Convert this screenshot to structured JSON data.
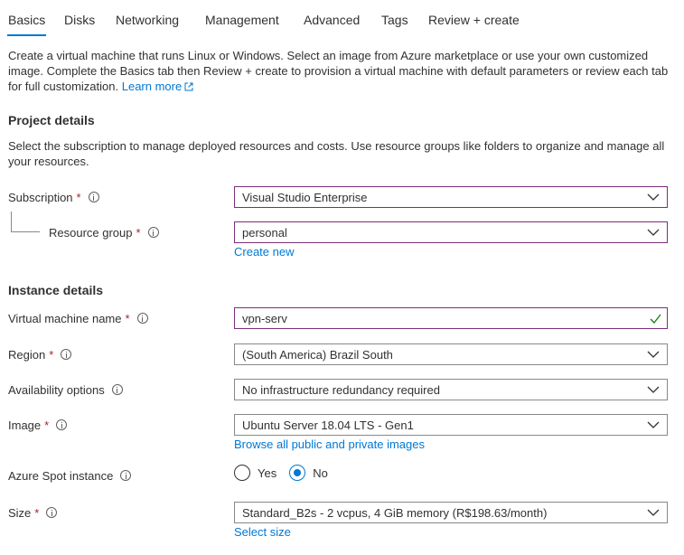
{
  "tabs": [
    {
      "label": "Basics",
      "active": true
    },
    {
      "label": "Disks"
    },
    {
      "label": "Networking"
    },
    {
      "label": "Management"
    },
    {
      "label": "Advanced"
    },
    {
      "label": "Tags"
    },
    {
      "label": "Review + create"
    }
  ],
  "intro": {
    "text": "Create a virtual machine that runs Linux or Windows. Select an image from Azure marketplace or use your own customized image. Complete the Basics tab then Review + create to provision a virtual machine with default parameters or review each tab for full customization.",
    "learn_more": "Learn more"
  },
  "project": {
    "heading": "Project details",
    "description": "Select the subscription to manage deployed resources and costs. Use resource groups like folders to organize and manage all your resources.",
    "subscription_label": "Subscription",
    "subscription_value": "Visual Studio Enterprise",
    "resource_group_label": "Resource group",
    "resource_group_value": "personal",
    "create_new": "Create new"
  },
  "instance": {
    "heading": "Instance details",
    "vm_name_label": "Virtual machine name",
    "vm_name_value": "vpn-serv",
    "region_label": "Region",
    "region_value": "(South America) Brazil South",
    "availability_label": "Availability options",
    "availability_value": "No infrastructure redundancy required",
    "image_label": "Image",
    "image_value": "Ubuntu Server 18.04 LTS - Gen1",
    "browse_images": "Browse all public and private images",
    "spot_label": "Azure Spot instance",
    "spot_yes": "Yes",
    "spot_no": "No",
    "spot_selected": "No",
    "size_label": "Size",
    "size_value": "Standard_B2s - 2 vcpus, 4 GiB memory (R$198.63/month)",
    "select_size": "Select size"
  },
  "required_mark": "*",
  "colors": {
    "accent": "#0078d4",
    "required": "#a4262c",
    "focus_border": "#7a2f7a",
    "valid_check": "#107c10"
  }
}
